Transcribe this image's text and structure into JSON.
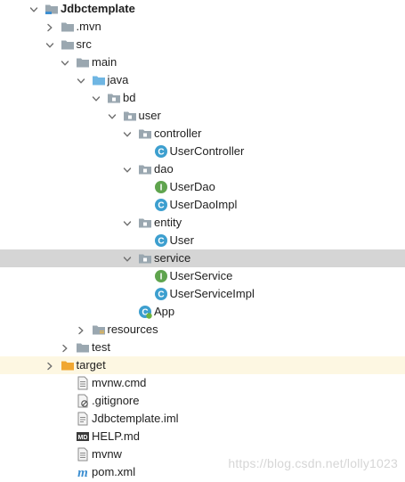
{
  "project_tree": {
    "items": [
      {
        "label": "Jdbctemplate",
        "depth": 0,
        "arrow": "down",
        "icon": "project-folder-icon",
        "bold": true
      },
      {
        "label": ".mvn",
        "depth": 1,
        "arrow": "right",
        "icon": "folder-icon"
      },
      {
        "label": "src",
        "depth": 1,
        "arrow": "down",
        "icon": "folder-icon"
      },
      {
        "label": "main",
        "depth": 2,
        "arrow": "down",
        "icon": "folder-icon"
      },
      {
        "label": "java",
        "depth": 3,
        "arrow": "down",
        "icon": "source-folder-icon"
      },
      {
        "label": "bd",
        "depth": 4,
        "arrow": "down",
        "icon": "package-icon"
      },
      {
        "label": "user",
        "depth": 5,
        "arrow": "down",
        "icon": "package-icon"
      },
      {
        "label": "controller",
        "depth": 6,
        "arrow": "down",
        "icon": "package-icon"
      },
      {
        "label": "UserController",
        "depth": 7,
        "arrow": "none",
        "icon": "class-icon"
      },
      {
        "label": "dao",
        "depth": 6,
        "arrow": "down",
        "icon": "package-icon"
      },
      {
        "label": "UserDao",
        "depth": 7,
        "arrow": "none",
        "icon": "interface-icon"
      },
      {
        "label": "UserDaoImpl",
        "depth": 7,
        "arrow": "none",
        "icon": "class-icon"
      },
      {
        "label": "entity",
        "depth": 6,
        "arrow": "down",
        "icon": "package-icon"
      },
      {
        "label": "User",
        "depth": 7,
        "arrow": "none",
        "icon": "class-icon"
      },
      {
        "label": "service",
        "depth": 6,
        "arrow": "down",
        "icon": "package-icon",
        "selected": true
      },
      {
        "label": "UserService",
        "depth": 7,
        "arrow": "none",
        "icon": "interface-icon"
      },
      {
        "label": "UserServiceImpl",
        "depth": 7,
        "arrow": "none",
        "icon": "class-icon"
      },
      {
        "label": "App",
        "depth": 6,
        "arrow": "none",
        "icon": "spring-app-icon"
      },
      {
        "label": "resources",
        "depth": 3,
        "arrow": "right",
        "icon": "resources-folder-icon"
      },
      {
        "label": "test",
        "depth": 2,
        "arrow": "right",
        "icon": "folder-icon"
      },
      {
        "label": "target",
        "depth": 1,
        "arrow": "right",
        "icon": "excluded-folder-icon",
        "excluded": true
      },
      {
        "label": "mvnw.cmd",
        "depth": 2,
        "arrow": "none",
        "icon": "text-file-icon"
      },
      {
        "label": ".gitignore",
        "depth": 2,
        "arrow": "none",
        "icon": "ignore-file-icon"
      },
      {
        "label": "Jdbctemplate.iml",
        "depth": 2,
        "arrow": "none",
        "icon": "iml-file-icon"
      },
      {
        "label": "HELP.md",
        "depth": 2,
        "arrow": "none",
        "icon": "markdown-file-icon"
      },
      {
        "label": "mvnw",
        "depth": 2,
        "arrow": "none",
        "icon": "text-file-icon"
      },
      {
        "label": "pom.xml",
        "depth": 2,
        "arrow": "none",
        "icon": "maven-file-icon"
      }
    ]
  },
  "colors": {
    "selected_row": "#d5d5d5",
    "excluded_row": "#fdf7e2",
    "class_icon": "#3d9fcf",
    "interface_icon": "#5fa44e",
    "folder": "#9aa7b0",
    "source_folder": "#6fb6e3",
    "excluded_folder": "#f0a732"
  },
  "watermark": "https://blog.csdn.net/lolly1023"
}
